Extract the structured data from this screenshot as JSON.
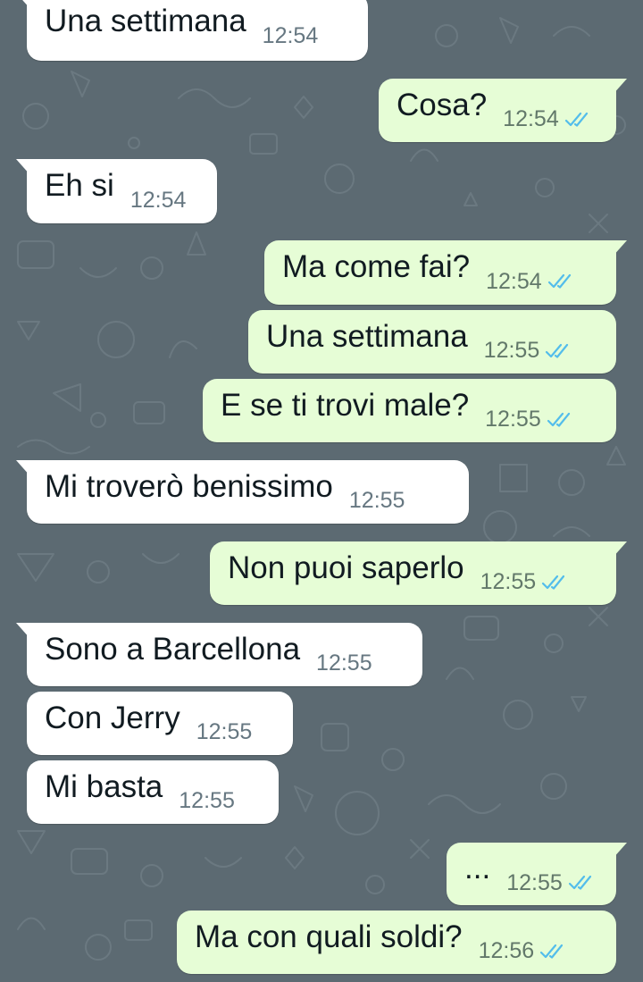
{
  "chat": {
    "messages": [
      {
        "direction": "in",
        "text": "Una settimana",
        "time": "12:54",
        "read": false
      },
      {
        "direction": "out",
        "text": "Cosa?",
        "time": "12:54",
        "read": true
      },
      {
        "direction": "in",
        "text": "Eh si",
        "time": "12:54",
        "read": false
      },
      {
        "direction": "out",
        "text": "Ma come fai?",
        "time": "12:54",
        "read": true
      },
      {
        "direction": "out",
        "text": "Una settimana",
        "time": "12:55",
        "read": true
      },
      {
        "direction": "out",
        "text": "E se ti trovi male?",
        "time": "12:55",
        "read": true
      },
      {
        "direction": "in",
        "text": "Mi troverò benissimo",
        "time": "12:55",
        "read": false
      },
      {
        "direction": "out",
        "text": "Non puoi saperlo",
        "time": "12:55",
        "read": true
      },
      {
        "direction": "in",
        "text": "Sono a Barcellona",
        "time": "12:55",
        "read": false
      },
      {
        "direction": "in",
        "text": "Con Jerry",
        "time": "12:55",
        "read": false
      },
      {
        "direction": "in",
        "text": "Mi basta",
        "time": "12:55",
        "read": false
      },
      {
        "direction": "out",
        "text": "...",
        "time": "12:55",
        "read": true
      },
      {
        "direction": "out",
        "text": "Ma con quali soldi?",
        "time": "12:56",
        "read": true
      }
    ]
  },
  "colors": {
    "wallpaper": "#5c6a72",
    "incoming_bubble": "#ffffff",
    "outgoing_bubble": "#e6fdd6",
    "read_ticks": "#53bdeb"
  },
  "icons": {
    "read_receipt": "double-check-icon"
  }
}
